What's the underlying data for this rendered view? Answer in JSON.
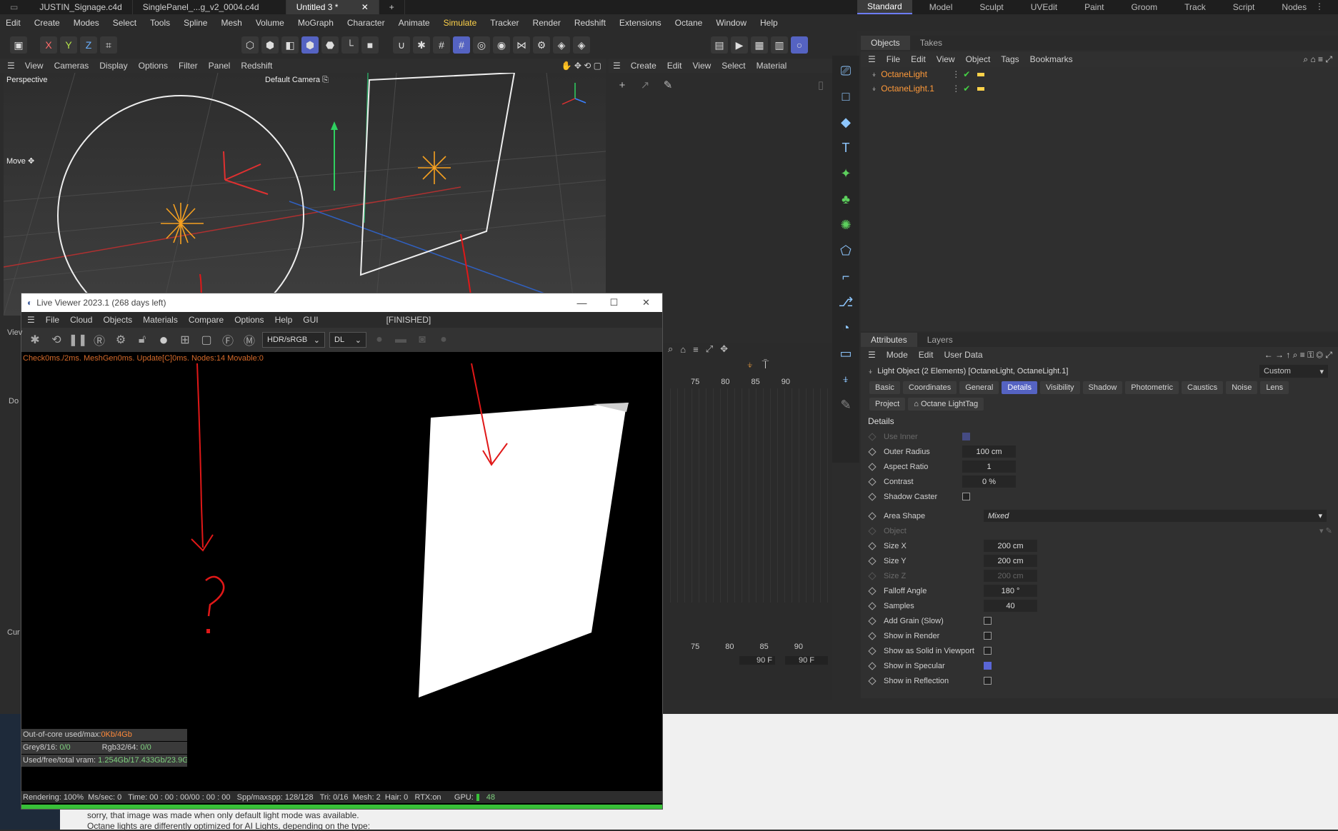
{
  "tabs": {
    "docs": [
      "JUSTIN_Signage.c4d",
      "SinglePanel_...g_v2_0004.c4d",
      "Untitled 3 *"
    ],
    "layouts": [
      "Standard",
      "Model",
      "Sculpt",
      "UVEdit",
      "Paint",
      "Groom",
      "Track",
      "Script",
      "Nodes"
    ]
  },
  "main_menu": [
    "Edit",
    "Create",
    "Modes",
    "Select",
    "Tools",
    "Spline",
    "Mesh",
    "Volume",
    "MoGraph",
    "Character",
    "Animate",
    "Simulate",
    "Tracker",
    "Render",
    "Redshift",
    "Extensions",
    "Octane",
    "Window",
    "Help"
  ],
  "viewport": {
    "menu": [
      "View",
      "Cameras",
      "Display",
      "Options",
      "Filter",
      "Panel",
      "Redshift"
    ],
    "label": "Perspective",
    "camera": "Default Camera",
    "tool": "Move",
    "clipped_label": "Viev"
  },
  "material": {
    "menu": [
      "Create",
      "Edit",
      "View",
      "Select",
      "Material"
    ]
  },
  "objects": {
    "tabs": [
      "Objects",
      "Takes"
    ],
    "menu": [
      "File",
      "Edit",
      "View",
      "Object",
      "Tags",
      "Bookmarks"
    ],
    "items": [
      "OctaneLight",
      "OctaneLight.1"
    ]
  },
  "attributes": {
    "tabs": [
      "Attributes",
      "Layers"
    ],
    "menu": [
      "Mode",
      "Edit",
      "User Data"
    ],
    "title": "Light Object (2 Elements) [OctaneLight, OctaneLight.1]",
    "preset": "Custom",
    "chips": [
      "Basic",
      "Coordinates",
      "General",
      "Details",
      "Visibility",
      "Shadow",
      "Photometric",
      "Caustics",
      "Noise",
      "Lens",
      "Project",
      "Octane LightTag"
    ],
    "section": "Details",
    "props": [
      {
        "label": "Use Inner",
        "val": "",
        "kind": "check-on-dim"
      },
      {
        "label": "Outer Radius",
        "val": "100 cm",
        "kind": "field"
      },
      {
        "label": "Aspect Ratio",
        "val": "1",
        "kind": "field"
      },
      {
        "label": "Contrast",
        "val": "0 %",
        "kind": "field"
      },
      {
        "label": "Shadow Caster",
        "val": "",
        "kind": "check-off"
      },
      {
        "label": "Area Shape",
        "val": "Mixed",
        "kind": "dropdown"
      },
      {
        "label": "Object",
        "val": "",
        "kind": "dim"
      },
      {
        "label": "Size X",
        "val": "200 cm",
        "kind": "field"
      },
      {
        "label": "Size Y",
        "val": "200 cm",
        "kind": "field"
      },
      {
        "label": "Size Z",
        "val": "200 cm",
        "kind": "dim-field"
      },
      {
        "label": "Falloff Angle",
        "val": "180 °",
        "kind": "field"
      },
      {
        "label": "Samples",
        "val": "40",
        "kind": "field"
      },
      {
        "label": "Add Grain (Slow)",
        "val": "",
        "kind": "check-off"
      },
      {
        "label": "Show in Render",
        "val": "",
        "kind": "check-off"
      },
      {
        "label": "Show as Solid in Viewport",
        "val": "",
        "kind": "check-off"
      },
      {
        "label": "Show in Specular",
        "val": "",
        "kind": "check-on"
      },
      {
        "label": "Show in Reflection",
        "val": "",
        "kind": "check-off"
      }
    ]
  },
  "timeline": {
    "ticks_top": [
      "75",
      "80",
      "85",
      "90"
    ],
    "ticks_bottom": [
      "75",
      "80",
      "85",
      "90"
    ],
    "frame_a": "90 F",
    "frame_b": "90 F"
  },
  "live_viewer": {
    "title": "Live Viewer 2023.1 (268 days left)",
    "menu": [
      "File",
      "Cloud",
      "Objects",
      "Materials",
      "Compare",
      "Options",
      "Help",
      "GUI"
    ],
    "state": "[FINISHED]",
    "color_mode": "HDR/sRGB",
    "kernel": "DL",
    "log": "Check0ms./2ms. MeshGen0ms. Update[C]0ms. Nodes:14 Movable:0",
    "stats": {
      "ooc_label": "Out-of-core used/max:",
      "ooc_val": "0Kb/4Gb",
      "grey_label": "Grey8/16:",
      "grey_val": "0/0",
      "rgb_label": "Rgb32/64:",
      "rgb_val": "0/0",
      "vram_label": "Used/free/total vram:",
      "vram_val": "1.254Gb/17.433Gb/23.9Gb"
    },
    "status": "Rendering: 100%  Ms/sec: 0   Time: 00 : 00 : 00/00 : 00 : 00   Spp/maxspp: 128/128   Tri: 0/16  Mesh: 2  Hair: 0   RTX:on      GPU:",
    "gpu_val": "48",
    "progress": 1.0
  },
  "left_clipped": [
    "Do",
    "Cur"
  ],
  "forum": {
    "line1": "sorry, that image was made when only default light mode was available.",
    "line2": "Octane lights are differently optimized for AI Lights, depending on the type:"
  },
  "colors": {
    "accent": "#5563c2",
    "light": "#ff9a3a",
    "annotation": "#e02020",
    "progress": "#38c038"
  }
}
